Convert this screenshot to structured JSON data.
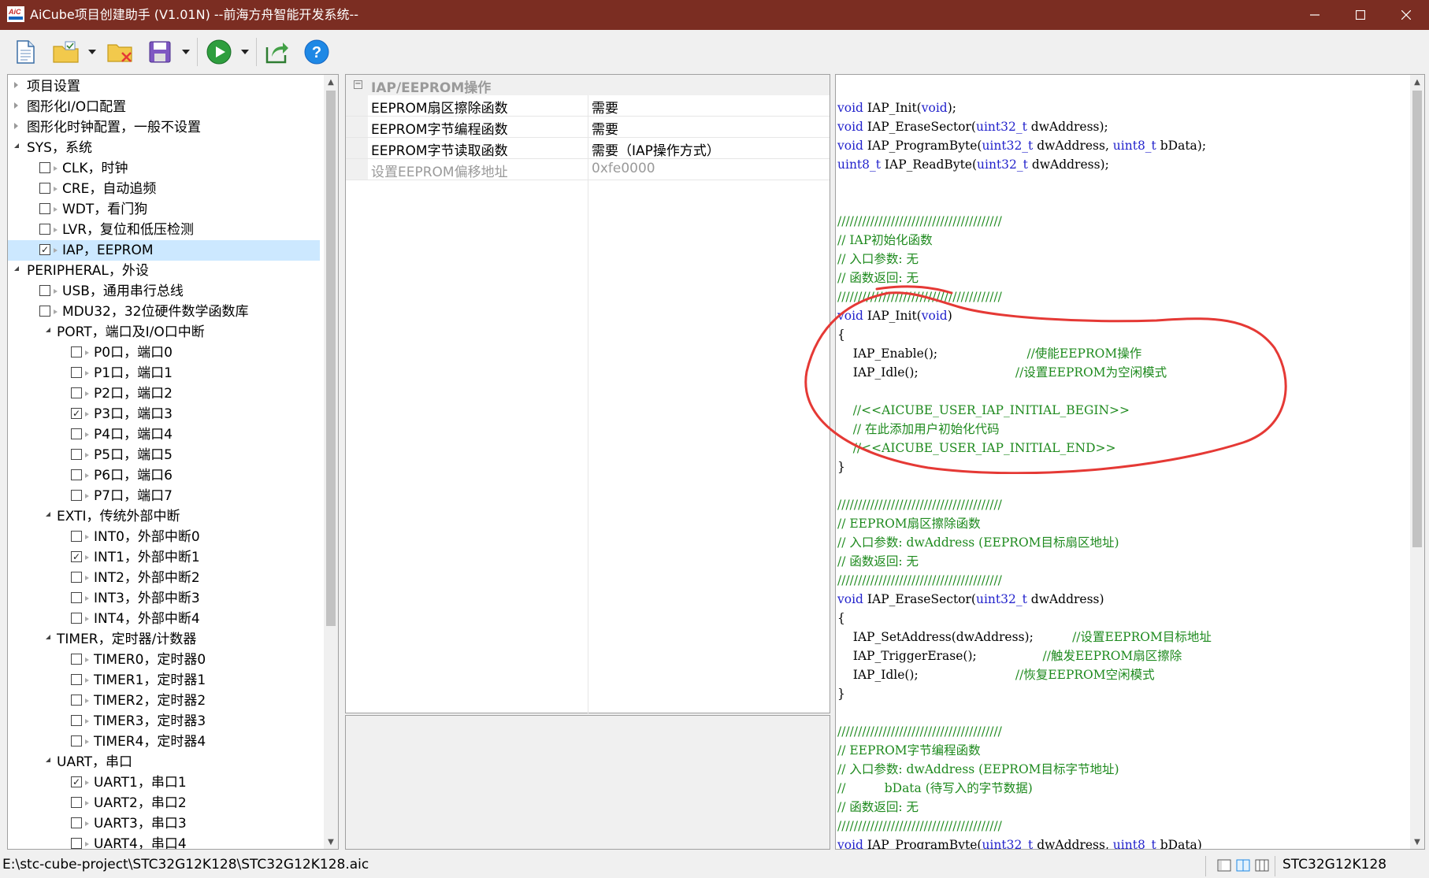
{
  "window": {
    "title": "AiCube项目创建助手 (V1.01N) --前海方舟智能开发系统--",
    "icon_text": "AiC"
  },
  "toolbar": {
    "buttons": [
      "new-file-icon",
      "open-project-icon",
      "close-project-icon",
      "save-icon",
      "run-icon",
      "export-icon",
      "help-icon"
    ],
    "help_label": "?"
  },
  "tree": {
    "items": [
      {
        "label": "项目设置",
        "level": 0,
        "type": "leaf",
        "checked": null,
        "selected": false
      },
      {
        "label": "图形化I/O口配置",
        "level": 0,
        "type": "leaf",
        "checked": null,
        "selected": false
      },
      {
        "label": "图形化时钟配置，一般不设置",
        "level": 0,
        "type": "leaf",
        "checked": null,
        "selected": false
      },
      {
        "label": "SYS，系统",
        "level": 0,
        "type": "group",
        "checked": null,
        "selected": false
      },
      {
        "label": "CLK，时钟",
        "level": 1,
        "type": "check",
        "checked": false,
        "selected": false
      },
      {
        "label": "CRE，自动追频",
        "level": 1,
        "type": "check",
        "checked": false,
        "selected": false
      },
      {
        "label": "WDT，看门狗",
        "level": 1,
        "type": "check",
        "checked": false,
        "selected": false
      },
      {
        "label": "LVR，复位和低压检测",
        "level": 1,
        "type": "check",
        "checked": false,
        "selected": false
      },
      {
        "label": "IAP，EEPROM",
        "level": 1,
        "type": "check",
        "checked": true,
        "selected": true
      },
      {
        "label": "PERIPHERAL，外设",
        "level": 0,
        "type": "group",
        "checked": null,
        "selected": false
      },
      {
        "label": "USB，通用串行总线",
        "level": 1,
        "type": "check",
        "checked": false,
        "selected": false
      },
      {
        "label": "MDU32，32位硬件数学函数库",
        "level": 1,
        "type": "check",
        "checked": false,
        "selected": false
      },
      {
        "label": "PORT，端口及I/O口中断",
        "level": 1,
        "type": "group",
        "checked": null,
        "selected": false
      },
      {
        "label": "P0口，端口0",
        "level": 2,
        "type": "check",
        "checked": false,
        "selected": false
      },
      {
        "label": "P1口，端口1",
        "level": 2,
        "type": "check",
        "checked": false,
        "selected": false
      },
      {
        "label": "P2口，端口2",
        "level": 2,
        "type": "check",
        "checked": false,
        "selected": false
      },
      {
        "label": "P3口，端口3",
        "level": 2,
        "type": "check",
        "checked": true,
        "selected": false
      },
      {
        "label": "P4口，端口4",
        "level": 2,
        "type": "check",
        "checked": false,
        "selected": false
      },
      {
        "label": "P5口，端口5",
        "level": 2,
        "type": "check",
        "checked": false,
        "selected": false
      },
      {
        "label": "P6口，端口6",
        "level": 2,
        "type": "check",
        "checked": false,
        "selected": false
      },
      {
        "label": "P7口，端口7",
        "level": 2,
        "type": "check",
        "checked": false,
        "selected": false
      },
      {
        "label": "EXTI，传统外部中断",
        "level": 1,
        "type": "group",
        "checked": null,
        "selected": false
      },
      {
        "label": "INT0，外部中断0",
        "level": 2,
        "type": "check",
        "checked": false,
        "selected": false
      },
      {
        "label": "INT1，外部中断1",
        "level": 2,
        "type": "check",
        "checked": true,
        "selected": false
      },
      {
        "label": "INT2，外部中断2",
        "level": 2,
        "type": "check",
        "checked": false,
        "selected": false
      },
      {
        "label": "INT3，外部中断3",
        "level": 2,
        "type": "check",
        "checked": false,
        "selected": false
      },
      {
        "label": "INT4，外部中断4",
        "level": 2,
        "type": "check",
        "checked": false,
        "selected": false
      },
      {
        "label": "TIMER，定时器/计数器",
        "level": 1,
        "type": "group",
        "checked": null,
        "selected": false
      },
      {
        "label": "TIMER0，定时器0",
        "level": 2,
        "type": "check",
        "checked": false,
        "selected": false
      },
      {
        "label": "TIMER1，定时器1",
        "level": 2,
        "type": "check",
        "checked": false,
        "selected": false
      },
      {
        "label": "TIMER2，定时器2",
        "level": 2,
        "type": "check",
        "checked": false,
        "selected": false
      },
      {
        "label": "TIMER3，定时器3",
        "level": 2,
        "type": "check",
        "checked": false,
        "selected": false
      },
      {
        "label": "TIMER4，定时器4",
        "level": 2,
        "type": "check",
        "checked": false,
        "selected": false
      },
      {
        "label": "UART，串口",
        "level": 1,
        "type": "group",
        "checked": null,
        "selected": false
      },
      {
        "label": "UART1，串口1",
        "level": 2,
        "type": "check",
        "checked": true,
        "selected": false
      },
      {
        "label": "UART2，串口2",
        "level": 2,
        "type": "check",
        "checked": false,
        "selected": false
      },
      {
        "label": "UART3，串口3",
        "level": 2,
        "type": "check",
        "checked": false,
        "selected": false
      },
      {
        "label": "UART4，串口4",
        "level": 2,
        "type": "check",
        "checked": false,
        "selected": false
      }
    ]
  },
  "properties": {
    "category": "IAP/EEPROM操作",
    "rows": [
      {
        "name": "EEPROM扇区擦除函数",
        "value": "需要",
        "disabled": false
      },
      {
        "name": "EEPROM字节编程函数",
        "value": "需要",
        "disabled": false
      },
      {
        "name": "EEPROM字节读取函数",
        "value": "需要（IAP操作方式）",
        "disabled": false
      },
      {
        "name": "设置EEPROM偏移地址",
        "value": "0xfe0000",
        "disabled": true
      }
    ]
  },
  "code": {
    "lines": [
      [],
      [
        {
          "t": "void",
          "c": "kw"
        },
        {
          "t": " IAP_Init(",
          "c": ""
        },
        {
          "t": "void",
          "c": "kw"
        },
        {
          "t": ");",
          "c": ""
        }
      ],
      [
        {
          "t": "void",
          "c": "kw"
        },
        {
          "t": " IAP_EraseSector(",
          "c": ""
        },
        {
          "t": "uint32_t",
          "c": "kw"
        },
        {
          "t": " dwAddress);",
          "c": ""
        }
      ],
      [
        {
          "t": "void",
          "c": "kw"
        },
        {
          "t": " IAP_ProgramByte(",
          "c": ""
        },
        {
          "t": "uint32_t",
          "c": "kw"
        },
        {
          "t": " dwAddress, ",
          "c": ""
        },
        {
          "t": "uint8_t",
          "c": "kw"
        },
        {
          "t": " bData);",
          "c": ""
        }
      ],
      [
        {
          "t": "uint8_t",
          "c": "kw"
        },
        {
          "t": " IAP_ReadByte(",
          "c": ""
        },
        {
          "t": "uint32_t",
          "c": "kw"
        },
        {
          "t": " dwAddress);",
          "c": ""
        }
      ],
      [],
      [],
      [
        {
          "t": "////////////////////////////////////////",
          "c": "comment"
        }
      ],
      [
        {
          "t": "// IAP初始化函数",
          "c": "comment"
        }
      ],
      [
        {
          "t": "// 入口参数: 无",
          "c": "comment"
        }
      ],
      [
        {
          "t": "// 函数返回: 无",
          "c": "comment"
        }
      ],
      [
        {
          "t": "////////////////////////////////////////",
          "c": "comment"
        }
      ],
      [
        {
          "t": "void",
          "c": "kw"
        },
        {
          "t": " IAP_Init(",
          "c": ""
        },
        {
          "t": "void",
          "c": "kw"
        },
        {
          "t": ")",
          "c": ""
        }
      ],
      [
        {
          "t": "{",
          "c": ""
        }
      ],
      [
        {
          "t": "    IAP_Enable();                       ",
          "c": ""
        },
        {
          "t": "//使能EEPROM操作",
          "c": "comment"
        }
      ],
      [
        {
          "t": "    IAP_Idle();                         ",
          "c": ""
        },
        {
          "t": "//设置EEPROM为空闲模式",
          "c": "comment"
        }
      ],
      [],
      [
        {
          "t": "    //<<AICUBE_USER_IAP_INITIAL_BEGIN>>",
          "c": "comment"
        }
      ],
      [
        {
          "t": "    // 在此添加用户初始化代码",
          "c": "comment"
        }
      ],
      [
        {
          "t": "    //<<AICUBE_USER_IAP_INITIAL_END>>",
          "c": "comment"
        }
      ],
      [
        {
          "t": "}",
          "c": ""
        }
      ],
      [],
      [
        {
          "t": "////////////////////////////////////////",
          "c": "comment"
        }
      ],
      [
        {
          "t": "// EEPROM扇区擦除函数",
          "c": "comment"
        }
      ],
      [
        {
          "t": "// 入口参数: dwAddress (EEPROM目标扇区地址)",
          "c": "comment"
        }
      ],
      [
        {
          "t": "// 函数返回: 无",
          "c": "comment"
        }
      ],
      [
        {
          "t": "////////////////////////////////////////",
          "c": "comment"
        }
      ],
      [
        {
          "t": "void",
          "c": "kw"
        },
        {
          "t": " IAP_EraseSector(",
          "c": ""
        },
        {
          "t": "uint32_t",
          "c": "kw"
        },
        {
          "t": " dwAddress)",
          "c": ""
        }
      ],
      [
        {
          "t": "{",
          "c": ""
        }
      ],
      [
        {
          "t": "    IAP_SetAddress(dwAddress);          ",
          "c": ""
        },
        {
          "t": "//设置EEPROM目标地址",
          "c": "comment"
        }
      ],
      [
        {
          "t": "    IAP_TriggerErase();                 ",
          "c": ""
        },
        {
          "t": "//触发EEPROM扇区擦除",
          "c": "comment"
        }
      ],
      [
        {
          "t": "    IAP_Idle();                         ",
          "c": ""
        },
        {
          "t": "//恢复EEPROM空闲模式",
          "c": "comment"
        }
      ],
      [
        {
          "t": "}",
          "c": ""
        }
      ],
      [],
      [
        {
          "t": "////////////////////////////////////////",
          "c": "comment"
        }
      ],
      [
        {
          "t": "// EEPROM字节编程函数",
          "c": "comment"
        }
      ],
      [
        {
          "t": "// 入口参数: dwAddress (EEPROM目标字节地址)",
          "c": "comment"
        }
      ],
      [
        {
          "t": "//          bData (待写入的字节数据)",
          "c": "comment"
        }
      ],
      [
        {
          "t": "// 函数返回: 无",
          "c": "comment"
        }
      ],
      [
        {
          "t": "////////////////////////////////////////",
          "c": "comment"
        }
      ],
      [
        {
          "t": "void",
          "c": "kw"
        },
        {
          "t": " IAP_ProgramByte(",
          "c": ""
        },
        {
          "t": "uint32_t",
          "c": "kw"
        },
        {
          "t": " dwAddress, ",
          "c": ""
        },
        {
          "t": "uint8_t",
          "c": "kw"
        },
        {
          "t": " bData)",
          "c": ""
        }
      ]
    ]
  },
  "statusbar": {
    "path": "E:\\stc-cube-project\\STC32G12K128\\STC32G12K128.aic",
    "chip": "STC32G12K128"
  },
  "colors": {
    "titlebar": "#7b2d22",
    "selection": "#cce8ff",
    "comment": "#1e8a1e",
    "keyword": "#2222cc",
    "annotation": "#e53935"
  }
}
